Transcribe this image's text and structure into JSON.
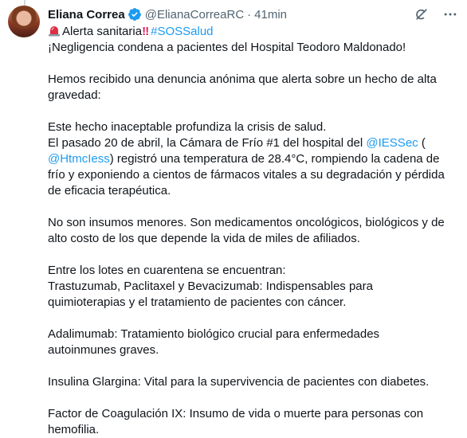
{
  "author": {
    "name": "Eliana Correa",
    "handle": "@ElianaCorreaRC",
    "separator": "·",
    "time": "41min"
  },
  "tweet": {
    "headline_text": "Alerta sanitaria",
    "headline_bangs": "‼",
    "hashtag": "#SOSSalud",
    "p1": "¡Negligencia condena a pacientes del Hospital Teodoro Maldonado!",
    "p2_l1": "Hemos recibido una denuncia anónima que alerta sobre un hecho de alta",
    "p2_l2": "gravedad:",
    "p3_l1": "Este hecho inaceptable  profundiza la crisis de salud.",
    "p3_l2a": "El pasado 20 de abril, la Cámara de Frío #1 del hospital del ",
    "mention_iess": "@IESSec",
    "p3_l2b": " (",
    "mention_htmc": "@HtmcIess",
    "p3_l3b": ") registró una temperatura de 28.4°C, rompiendo la cadena de",
    "p3_l4": "frío y exponiendo a cientos de fármacos vitales a su degradación y pérdida",
    "p3_l5": "de eficacia terapéutica.",
    "p4_l1": "No son insumos menores. Son medicamentos oncológicos, biológicos y de",
    "p4_l2": "alto costo de los que depende la vida de miles de afiliados.",
    "p5_l1": "Entre los lotes en cuarentena se encuentran:",
    "p5_l2": "Trastuzumab, Paclitaxel y Bevacizumab: Indispensables para",
    "p5_l3": "quimioterapias y el tratamiento de pacientes con cáncer.",
    "p6_l1": "Adalimumab: Tratamiento biológico crucial para enfermedades",
    "p6_l2": "autoinmunes graves.",
    "p7_l1": "Insulina Glargina: Vital para la supervivencia de pacientes con diabetes.",
    "p8_l1": "Factor de Coagulación IX: Insumo de vida o muerte para personas con",
    "p8_l2": "hemofilia."
  },
  "icons": {
    "verified": "verified-badge-icon",
    "grok": "grok-icon",
    "more": "more-icon",
    "alert": "rotating-light-icon"
  },
  "colors": {
    "link": "#1d9bf0",
    "muted": "#536471",
    "text": "#0f1419",
    "verified": "#1d9bf0",
    "bangs": "#e0245e"
  }
}
